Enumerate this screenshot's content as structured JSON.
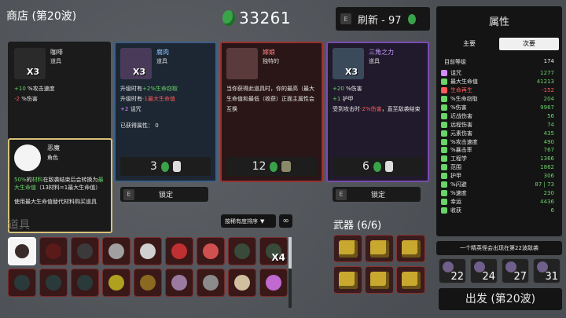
{
  "header": {
    "title": "商店 (第20波)",
    "materials": "33261",
    "refresh_key": "E",
    "refresh_label": "刷新 - 97"
  },
  "colors": {
    "card_common": "#1b1b1b",
    "card_uncommon": "#2f4a66",
    "card_rare": "#7a2424",
    "card_legendary": "#4a2f6e",
    "material": "#3aa34a"
  },
  "cards": [
    {
      "name": "咖啡",
      "type": "道具",
      "count": "X3",
      "lines": [
        {
          "a": "+10",
          "b": "%攻击速度",
          "c": "green"
        },
        {
          "a": "-2",
          "b": "%伤害",
          "c": "red"
        }
      ],
      "price": "",
      "icon": "coffee-icon"
    },
    {
      "name": "腐肉",
      "type": "道具",
      "count": "X3",
      "lines": [
        {
          "a": "升级时有",
          "b": "+2%生命窃取",
          "c": "green"
        },
        {
          "a": "升级时有",
          "b": "-1最大生命值",
          "c": "red"
        },
        {
          "a": "+2",
          "b": "诅咒",
          "c": "purple"
        },
        {
          "a": "",
          "b": "",
          "c": ""
        },
        {
          "a": "已获得属性：",
          "b": "0",
          "c": ""
        }
      ],
      "price": "3",
      "icon": "rotten-meat-icon"
    },
    {
      "name": "嫁娘",
      "type": "独特的",
      "count": "",
      "desc": "当你获得此道具时，你的最高（最大生命值和最低（收获）正面主属性会互换",
      "price": "12",
      "icon": "axolotl-icon"
    },
    {
      "name": "三角之力",
      "type": "道具",
      "count": "X3",
      "lines": [
        {
          "a": "+20",
          "b": "%伤害",
          "c": "green"
        },
        {
          "a": "+1",
          "b": "护甲",
          "c": "green"
        },
        {
          "a": "受到攻击时",
          "b": "-2%伤害",
          "c": "red"
        },
        {
          "a": "，直至敌袭结束",
          "b": "",
          "c": ""
        }
      ],
      "price": "6",
      "icon": "triangle-icon"
    }
  ],
  "lock": {
    "key": "E",
    "label": "锁定"
  },
  "tooltip": {
    "name": "恶魔",
    "type": "角色",
    "p1a": "50%",
    "p1b": "的",
    "p1c": "材料",
    "p1d": "在敌袭结束后会转换为",
    "p1e": "最大生命值",
    "p1f": "（13材料=1最大生命值）",
    "p2": "使用最大生命值替代材料购买道具"
  },
  "items": {
    "label": "道具",
    "sort_label": "按稀有度排序",
    "sort_icon": "∞"
  },
  "weapons": {
    "label": "武器 (6/6)"
  },
  "stats": {
    "title": "属性",
    "tab_main": "主要",
    "tab_secondary": "次要",
    "level_label": "目前等级",
    "level": "174",
    "rows": [
      {
        "name": "诅咒",
        "value": "1277",
        "color": "#d28cff"
      },
      {
        "name": "最大生命值",
        "value": "41213",
        "color": "#6ad36a"
      },
      {
        "name": "生命再生",
        "value": "-152",
        "color": "#ff5a5a"
      },
      {
        "name": "%生命窃取",
        "value": "204",
        "color": "#6ad36a"
      },
      {
        "name": "%伤害",
        "value": "9967",
        "color": "#6ad36a"
      },
      {
        "name": "近战伤害",
        "value": "56",
        "color": "#6ad36a"
      },
      {
        "name": "远程伤害",
        "value": "74",
        "color": "#6ad36a"
      },
      {
        "name": "元素伤害",
        "value": "435",
        "color": "#6ad36a"
      },
      {
        "name": "%攻击速度",
        "value": "490",
        "color": "#6ad36a"
      },
      {
        "name": "%暴击率",
        "value": "767",
        "color": "#6ad36a"
      },
      {
        "name": "工程学",
        "value": "1366",
        "color": "#6ad36a"
      },
      {
        "name": "范围",
        "value": "1862",
        "color": "#6ad36a"
      },
      {
        "name": "护甲",
        "value": "306",
        "color": "#6ad36a"
      },
      {
        "name": "%闪避",
        "value": "87 | 73",
        "color": "#6ad36a"
      },
      {
        "name": "%速度",
        "value": "230",
        "color": "#6ad36a"
      },
      {
        "name": "幸运",
        "value": "4436",
        "color": "#6ad36a"
      },
      {
        "name": "收获",
        "value": "6",
        "color": "#6ad36a"
      }
    ]
  },
  "elite_text": "一个精英怪会出现在第22波敌袭",
  "enemies": [
    "22",
    "24",
    "27",
    "31"
  ],
  "go_label": "出发 (第20波)"
}
